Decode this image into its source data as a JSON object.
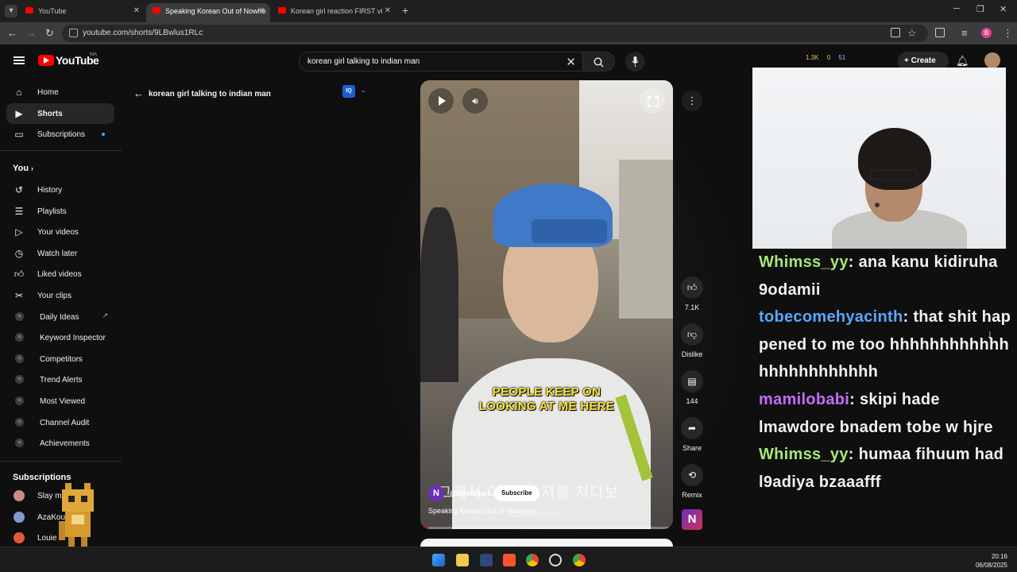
{
  "browser": {
    "tabs": [
      {
        "title": "YouTube",
        "active": false
      },
      {
        "title": "Speaking Korean Out of Nowhe",
        "active": true
      },
      {
        "title": "Korean girl reaction FIRST vi",
        "active": false
      }
    ],
    "url": "youtube.com/shorts/9LBwlus1RLc"
  },
  "yt_header": {
    "logo_text": "YouTube",
    "country": "MA",
    "search_query": "korean girl talking to indian man",
    "stats": [
      "1.3K",
      "0",
      "51"
    ],
    "create_label": "Create"
  },
  "sidebar": {
    "main": [
      {
        "label": "Home",
        "icon": "home-icon"
      },
      {
        "label": "Shorts",
        "icon": "shorts-icon",
        "selected": true
      },
      {
        "label": "Subscriptions",
        "icon": "subscriptions-icon",
        "dot": true
      }
    ],
    "you_label": "You",
    "you_items": [
      {
        "label": "History",
        "icon": "history-icon"
      },
      {
        "label": "Playlists",
        "icon": "playlists-icon"
      },
      {
        "label": "Your videos",
        "icon": "your-videos-icon"
      },
      {
        "label": "Watch later",
        "icon": "watch-later-icon"
      },
      {
        "label": "Liked videos",
        "icon": "liked-videos-icon"
      },
      {
        "label": "Your clips",
        "icon": "clips-icon"
      }
    ],
    "vidiq_items": [
      {
        "label": "Daily Ideas",
        "external": true
      },
      {
        "label": "Keyword Inspector"
      },
      {
        "label": "Competitors"
      },
      {
        "label": "Trend Alerts"
      },
      {
        "label": "Most Viewed"
      },
      {
        "label": "Channel Audit"
      },
      {
        "label": "Achievements"
      }
    ],
    "subscriptions_label": "Subscriptions",
    "subscriptions": [
      {
        "label": "Slay mla",
        "color": "#c98a8a"
      },
      {
        "label": "AzaKoun",
        "color": "#7d9bd0"
      },
      {
        "label": "Louie",
        "color": "#e05a3a"
      }
    ]
  },
  "shorts": {
    "back_label": "korean girl talking to indian man",
    "vidiq_badge": "IQ",
    "caption_line1": "PEOPLE KEEP ON",
    "caption_line2": "LOOKING AT ME HERE",
    "korean_subtitle": "그래서 이 자꾸 저를 쳐다보",
    "watermark": "@potatoturtleee",
    "channel_handle": "@Nextshark",
    "channel_initial": "N",
    "subscribe_label": "Subscribe",
    "video_title": "Speaking Korean Out of Nowhere",
    "progress": 0.03
  },
  "actions": {
    "likes": "7.1K",
    "dislike_label": "Dislike",
    "comments": "144",
    "share_label": "Share",
    "remix_label": "Remix",
    "remix_initial": "N"
  },
  "chat": [
    {
      "user": "Whimss_yy",
      "color_class": "u1",
      "message": "ana kanu kidiruha 9odamii"
    },
    {
      "user": "tobecomehyacinth",
      "color_class": "u2",
      "message": "that shit happened to me too hhhhhhhhhhhhhhhhhhhhhhhh"
    },
    {
      "user": "mamilobabi",
      "color_class": "u3",
      "message": "skipi hade lmawdore bnadem tobe w hjre"
    },
    {
      "user": "Whimss_yy",
      "color_class": "u1",
      "message": "humaa fihuum had l9adiya bzaaafff"
    }
  ],
  "taskbar": {
    "time": "20:16",
    "date": "06/08/2025"
  }
}
